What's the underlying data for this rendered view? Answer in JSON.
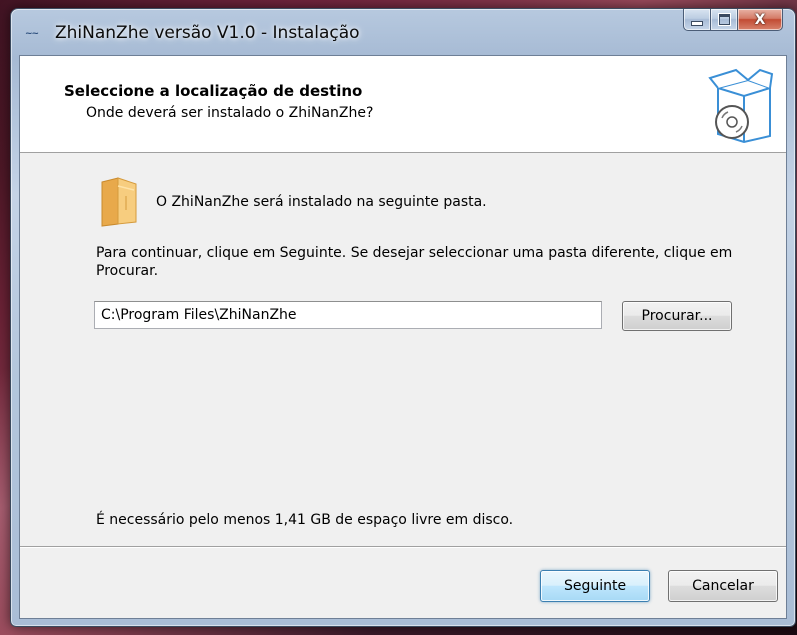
{
  "window": {
    "title": "ZhiNanZhe versão V1.0 - Instalação",
    "app_icon_glyph": "~~",
    "caption": {
      "minimize_glyph": "",
      "maximize_glyph": "",
      "close_glyph": "X"
    }
  },
  "header": {
    "title": "Seleccione a localização de destino",
    "subtitle": "Onde deverá ser instalado o ZhiNanZhe?",
    "graphic": "box-with-disc-icon"
  },
  "body": {
    "folder_icon": "folder-icon",
    "intro": "O ZhiNanZhe será instalado na seguinte pasta.",
    "instructions": "Para continuar, clique em Seguinte. Se desejar seleccionar uma pasta diferente, clique em Procurar.",
    "install_path": "C:\\Program Files\\ZhiNanZhe",
    "browse_label": "Procurar...",
    "space_required": "É necessário pelo menos 1,41 GB de espaço livre em disco."
  },
  "footer": {
    "next_label": "Seguinte",
    "cancel_label": "Cancelar"
  },
  "colors": {
    "accent_blue": "#3c7fb1",
    "folder_orange": "#f5c16c",
    "header_graphic_blue": "#3a8fd6"
  }
}
